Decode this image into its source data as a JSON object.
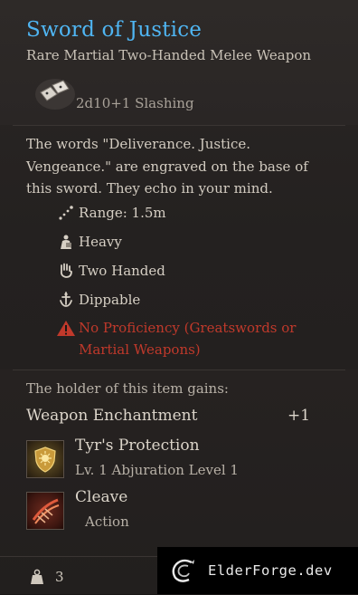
{
  "item": {
    "name": "Sword of Justice",
    "type_line": "Rare Martial Two-Handed Melee Weapon",
    "damage": "2d10+1 Slashing",
    "description": "The words \"Deliverance. Justice. Vengeance.\" are engraved on the base of this sword. They echo in your mind.",
    "properties": [
      {
        "label": "Range: 1.5m",
        "icon": "range-icon"
      },
      {
        "label": "Heavy",
        "icon": "heavy-icon"
      },
      {
        "label": "Two Handed",
        "icon": "two-handed-icon"
      },
      {
        "label": "Dippable",
        "icon": "dippable-icon"
      }
    ],
    "warning": "No Proficiency (Greatswords or Martial Weapons)"
  },
  "bonuses": {
    "heading": "The holder of this item gains:",
    "enchantment_label": "Weapon Enchantment",
    "enchantment_value": "+1",
    "skills": [
      {
        "name": "Tyr's Protection",
        "meta": "Lv. 1  Abjuration  Level 1",
        "icon": "shield-sun-icon"
      },
      {
        "name": "Cleave",
        "meta": "Action",
        "icon": "cleave-icon"
      }
    ]
  },
  "footer": {
    "weight": "3"
  },
  "watermark": {
    "text": "ElderForge.dev"
  },
  "colors": {
    "title": "#4fb5f2",
    "warning": "#c0392b"
  }
}
